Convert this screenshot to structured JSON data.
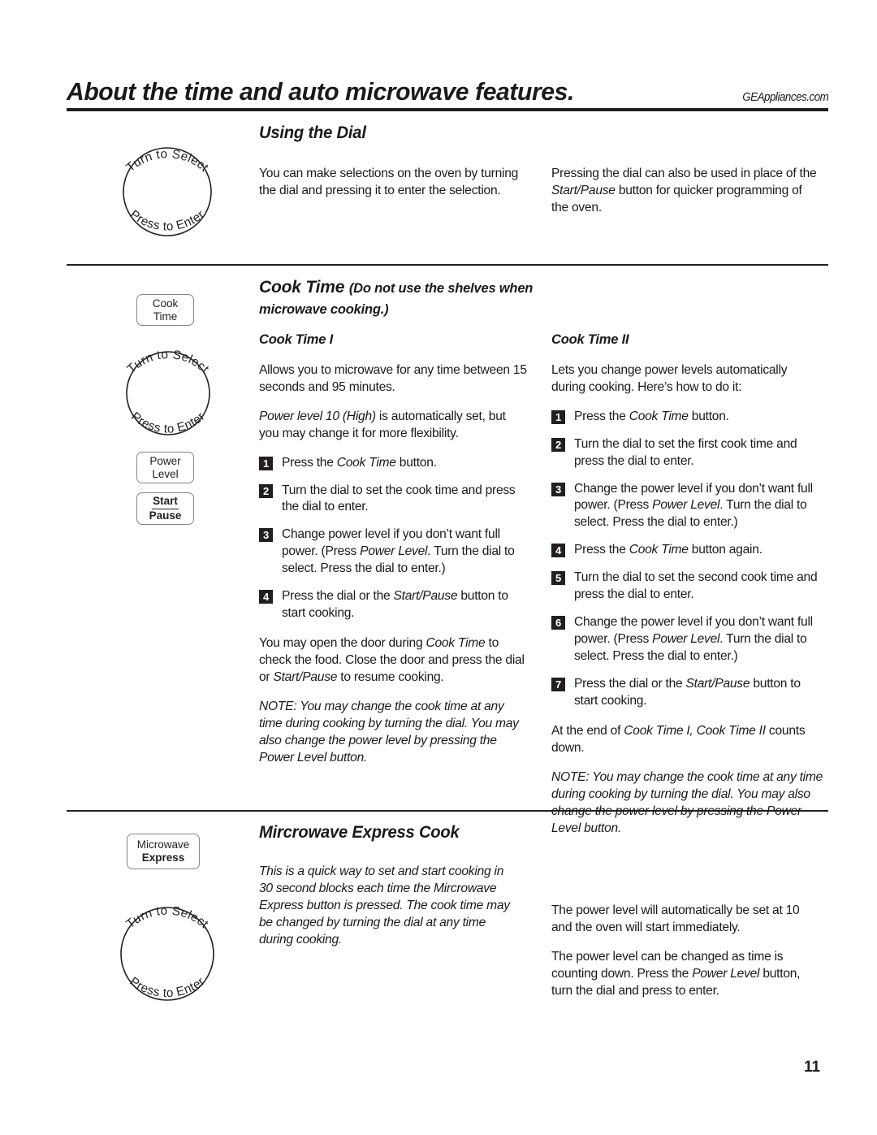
{
  "header": {
    "title": "About the time and auto microwave features.",
    "site": "GEAppliances.com"
  },
  "dial_labels": {
    "turn": "Turn to Select",
    "press": "Press to Enter"
  },
  "buttons": {
    "cook_time_l1": "Cook",
    "cook_time_l2": "Time",
    "power_level_l1": "Power",
    "power_level_l2": "Level",
    "start": "Start",
    "pause": "Pause",
    "microwave": "Microwave",
    "express": "Express"
  },
  "section_dial": {
    "heading": "Using the Dial",
    "left_text": "You can make selections on the oven by turning the dial and pressing it to enter the selection.",
    "right_text_1": "Pressing the dial can also be used in place of the ",
    "right_italic": "Start/Pause",
    "right_text_2": " button for quicker programming of the oven."
  },
  "section_cook_time": {
    "heading_main": "Cook Time",
    "heading_note": "(Do not use the shelves when microwave cooking.)",
    "col1": {
      "subhead": "Cook Time I",
      "intro": "Allows you to microwave for any time between 15 seconds and 95 minutes.",
      "power_note_italic": "Power level 10 (High)",
      "power_note_rest": " is automatically set, but you may change it for more flexibility.",
      "steps": [
        {
          "n": "1",
          "pre": "Press the ",
          "ital": "Cook Time",
          "post": " button."
        },
        {
          "n": "2",
          "pre": "Turn the dial to set the cook time and press the dial to enter.",
          "ital": "",
          "post": ""
        },
        {
          "n": "3",
          "pre": "Change power level if you don’t want full power. (Press ",
          "ital": "Power Level",
          "post": ". Turn the dial to select. Press the dial to enter.)"
        },
        {
          "n": "4",
          "pre": "Press the dial or the ",
          "ital": "Start/Pause",
          "post": " button to start cooking."
        }
      ],
      "door_p1": "You may open the door during ",
      "door_ital1": "Cook Time",
      "door_p2": " to check the food. Close the door and press the dial or ",
      "door_ital2": "Start/Pause",
      "door_p3": " to resume cooking.",
      "note": "NOTE: You may change the cook time at any time during cooking by turning the dial. You may also change the power level by pressing the Power Level button."
    },
    "col2": {
      "subhead": "Cook Time II",
      "intro": "Lets you change power levels automatically during cooking. Here’s how to do it:",
      "steps": [
        {
          "n": "1",
          "pre": "Press the ",
          "ital": "Cook Time",
          "post": " button."
        },
        {
          "n": "2",
          "pre": "Turn the dial to set the first cook time and press the dial to enter.",
          "ital": "",
          "post": ""
        },
        {
          "n": "3",
          "pre": "Change the power level if you don’t want full power. (Press ",
          "ital": "Power Level",
          "post": ". Turn the dial to select. Press the dial to enter.)"
        },
        {
          "n": "4",
          "pre": "Press the ",
          "ital": "Cook Time",
          "post": " button again."
        },
        {
          "n": "5",
          "pre": "Turn the dial to set the second cook time and press the dial to enter.",
          "ital": "",
          "post": ""
        },
        {
          "n": "6",
          "pre": "Change the power level if you don’t want full power. (Press ",
          "ital": "Power Level",
          "post": ". Turn the dial to select. Press the dial to enter.)"
        },
        {
          "n": "7",
          "pre": "Press the dial or the ",
          "ital": "Start/Pause",
          "post": " button to start cooking."
        }
      ],
      "end_p1": "At the end of ",
      "end_ital": "Cook Time I, Cook Time II",
      "end_p2": " counts down.",
      "note": "NOTE: You may change the cook time at any time during cooking by turning the dial. You may also change the power level by pressing the Power Level button."
    }
  },
  "section_express": {
    "heading": "Mircrowave Express Cook",
    "left_text": "This is a quick way to set and start cooking in 30 second blocks each time the Mircrowave Express button is pressed. The cook time may be changed by turning the dial at any time during cooking.",
    "right_text_1": "The power level will automatically be set at 10 and the oven will start immediately.",
    "right_text_2a": "The power level can be changed as time is counting down. Press the ",
    "right_italic": "Power Level",
    "right_text_2b": " button, turn the dial and press to enter."
  },
  "page_number": "11"
}
